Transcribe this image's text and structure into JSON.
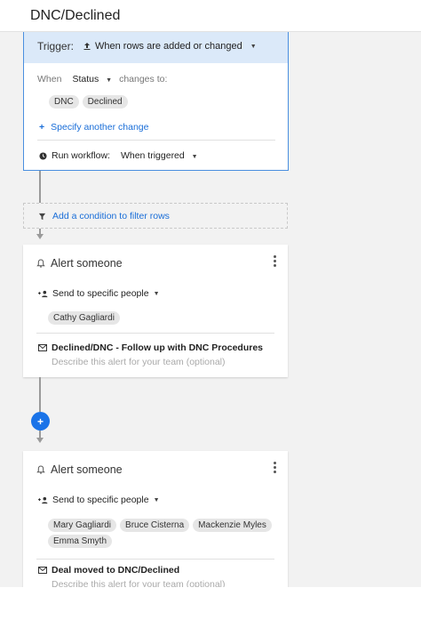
{
  "header": {
    "title": "DNC/Declined"
  },
  "trigger": {
    "label": "Trigger:",
    "select": "When rows are added or changed",
    "when_label": "When",
    "field": "Status",
    "changes_to": "changes to:",
    "values": [
      "DNC",
      "Declined"
    ],
    "add_change": "Specify another change",
    "run_label": "Run workflow:",
    "run_value": "When triggered"
  },
  "filter": {
    "label": "Add a condition to filter rows"
  },
  "alerts": [
    {
      "title": "Alert someone",
      "send_label": "Send to specific people",
      "recipients": [
        "Cathy Gagliardi"
      ],
      "message": "Declined/DNC - Follow up with DNC Procedures",
      "description_placeholder": "Describe this alert for your team (optional)"
    },
    {
      "title": "Alert someone",
      "send_label": "Send to specific people",
      "recipients": [
        "Mary Gagliardi",
        "Bruce Cisterna",
        "Mackenzie Myles",
        "Emma Smyth"
      ],
      "message": "Deal moved to DNC/Declined",
      "description_placeholder": "Describe this alert for your team (optional)"
    }
  ],
  "add_step": {
    "label": "+"
  },
  "colors": {
    "accent": "#1a73e8",
    "trigger_bg": "#dbe9f9",
    "link": "#1a6ed8"
  }
}
